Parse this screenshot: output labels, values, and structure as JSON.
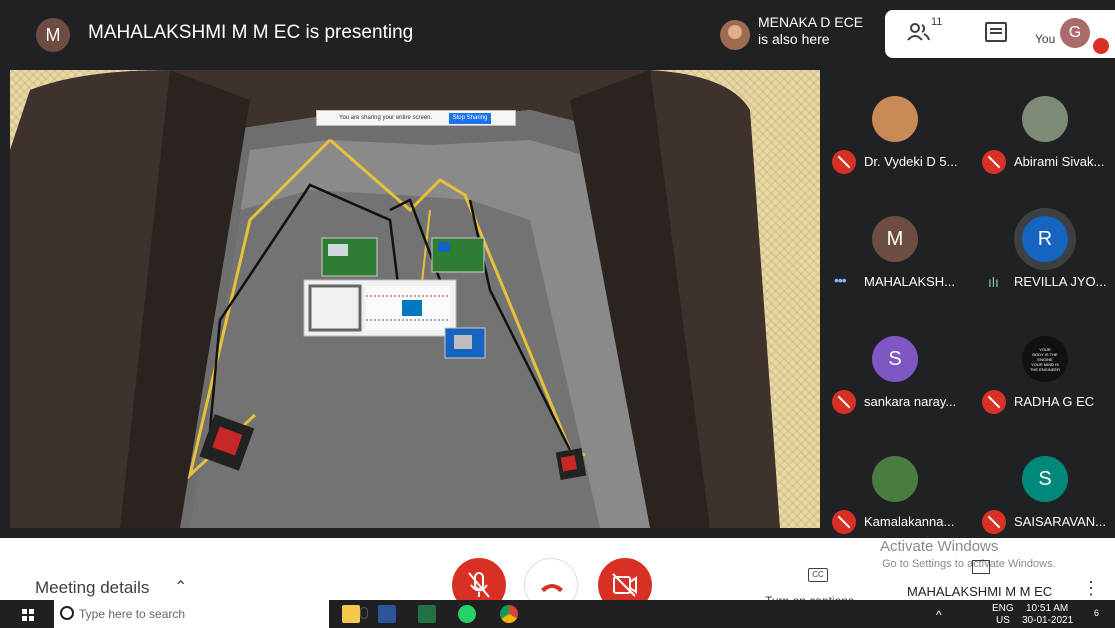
{
  "header": {
    "presenter_initial": "M",
    "presenter_title": "MAHALAKSHMI M M EC is presenting",
    "also_here_line1": "MENAKA D ECE",
    "also_here_line2": "is also here",
    "people_count": "11",
    "you_label": "You",
    "you_initial": "G"
  },
  "share_banner": {
    "message": "You are sharing your entire screen.",
    "stop_label": "Stop Sharing"
  },
  "participants": [
    {
      "name": "Dr. Vydeki D 5...",
      "initial": "",
      "avatar_color": "#c98a56",
      "status": "muted"
    },
    {
      "name": "Abirami Sivak...",
      "initial": "",
      "avatar_color": "#7d8b76",
      "status": "muted"
    },
    {
      "name": "MAHALAKSH...",
      "initial": "M",
      "avatar_color": "#6d4c41",
      "status": "dots"
    },
    {
      "name": "REVILLA JYO...",
      "initial": "R",
      "avatar_color": "#1565c0",
      "status": "speaking"
    },
    {
      "name": "sankara naray...",
      "initial": "S",
      "avatar_color": "#7e57c2",
      "status": "muted"
    },
    {
      "name": "RADHA G EC",
      "initial": "",
      "avatar_color": "#111111",
      "status": "muted"
    },
    {
      "name": "Kamalakanna...",
      "initial": "",
      "avatar_color": "#4a7c3f",
      "status": "muted"
    },
    {
      "name": "SAISARAVAN...",
      "initial": "S",
      "avatar_color": "#00897b",
      "status": "muted"
    }
  ],
  "poster_text": [
    "YOUR",
    "BODY IS THE",
    "ENGINE",
    "YOUR MIND IS",
    "THE ENGINEER"
  ],
  "bottom": {
    "meeting_details": "Meeting details",
    "captions": "Turn on captions",
    "cc": "CC",
    "activate_line1": "Activate Windows",
    "activate_line2": "Go to Settings to activate Windows.",
    "presenting_name": "MAHALAKSHMI M M EC"
  },
  "taskbar": {
    "search_placeholder": "Type here to search",
    "lang_top": "ENG",
    "lang_bottom": "US",
    "time": "10:51 AM",
    "date": "30-01-2021",
    "notif_count": "6"
  },
  "colors": {
    "danger": "#d93025",
    "bg_dark": "#202124",
    "accent_blue": "#1a73e8"
  }
}
